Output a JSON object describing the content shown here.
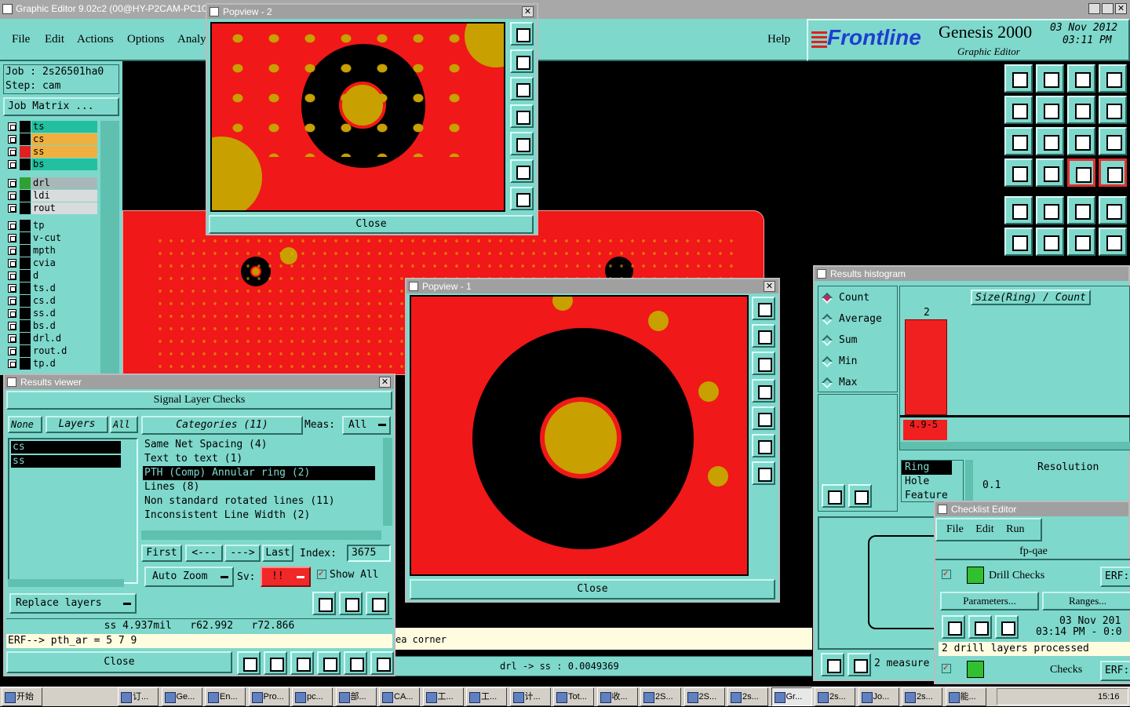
{
  "main": {
    "title": "Graphic Editor 9.02c2 (00@HY-P2CAM-PC10",
    "menu": [
      "File",
      "Edit",
      "Actions",
      "Options",
      "Analy"
    ],
    "help": "Help",
    "brand": "Frontline",
    "product": "Genesis 2000",
    "subtitle": "Graphic Editor",
    "date": "03 Nov 2012",
    "time": "03:11 PM",
    "job": "Job : 2s26501ha0",
    "step": "Step: cam",
    "job_matrix": "Job Matrix ...",
    "status_line": "drl -> ss : 0.0049369",
    "area_text": "ea corner"
  },
  "layers": [
    {
      "name": "ts",
      "color": "#22c0a0",
      "mark": "#000"
    },
    {
      "name": "cs",
      "color": "#f0b040",
      "mark": "#000"
    },
    {
      "name": "ss",
      "color": "#f0b040",
      "mark": "#e02020"
    },
    {
      "name": "bs",
      "color": "#22c0a0",
      "mark": "#000"
    },
    {
      "name": "drl",
      "color": "#a8b8b8",
      "mark": "#30a030"
    },
    {
      "name": "ldi",
      "color": "#d8dcdc",
      "mark": "#000"
    },
    {
      "name": "rout",
      "color": "#d8dcdc",
      "mark": "#000"
    },
    {
      "name": "tp",
      "color": "#7fd8cc",
      "mark": "#000"
    },
    {
      "name": "v-cut",
      "color": "#7fd8cc",
      "mark": "#000"
    },
    {
      "name": "mpth",
      "color": "#7fd8cc",
      "mark": "#000"
    },
    {
      "name": "cvia",
      "color": "#7fd8cc",
      "mark": "#000"
    },
    {
      "name": "d",
      "color": "#7fd8cc",
      "mark": "#000"
    },
    {
      "name": "ts.d",
      "color": "#7fd8cc",
      "mark": "#000"
    },
    {
      "name": "cs.d",
      "color": "#7fd8cc",
      "mark": "#000"
    },
    {
      "name": "ss.d",
      "color": "#7fd8cc",
      "mark": "#000"
    },
    {
      "name": "bs.d",
      "color": "#7fd8cc",
      "mark": "#000"
    },
    {
      "name": "drl.d",
      "color": "#7fd8cc",
      "mark": "#000"
    },
    {
      "name": "rout.d",
      "color": "#7fd8cc",
      "mark": "#000"
    },
    {
      "name": "tp.d",
      "color": "#7fd8cc",
      "mark": "#000"
    }
  ],
  "popview2": {
    "title": "Popview - 2",
    "close": "Close"
  },
  "popview1": {
    "title": "Popview - 1",
    "close": "Close"
  },
  "results": {
    "title": "Results viewer",
    "header": "Signal Layer Checks",
    "none": "None",
    "layers": "Layers",
    "all": "All",
    "categories": "Categories (11)",
    "meas_label": "Meas:",
    "meas_value": "All",
    "layer_items": [
      "cs",
      "ss"
    ],
    "cat_items": [
      "Same Net Spacing (4)",
      "Text to text (1)",
      "PTH (Comp) Annular ring (2)",
      "Lines (8)",
      "Non standard rotated lines (11)",
      "Inconsistent Line Width (2)"
    ],
    "first": "First",
    "prev": "<---",
    "next": "--->",
    "last": "Last",
    "index_label": "Index:",
    "index_value": "3675",
    "auto_zoom": "Auto Zoom",
    "sv_label": "Sv:",
    "sv_value": "!!",
    "show_all": "Show All",
    "replace_layers": "Replace layers",
    "info_line": "ss 4.937mil   r62.992   r72.866",
    "erf_line": "ERF--> pth_ar = 5 7 9",
    "close": "Close"
  },
  "histogram": {
    "title": "Results histogram",
    "options": [
      "Count",
      "Average",
      "Sum",
      "Min",
      "Max"
    ],
    "chart_title": "Size(Ring) / Count",
    "bar_value": "2",
    "bar_label": "4.9-5",
    "list": [
      "Ring",
      "Hole",
      "Feature"
    ],
    "resolution_label": "Resolution",
    "resolution_value": "0.1",
    "measure_text": "2 measure"
  },
  "checklist": {
    "title": "Checklist Editor",
    "menu": [
      "File",
      "Edit",
      "Run"
    ],
    "name": "fp-qae",
    "check1": "Drill Checks",
    "erf": "ERF:",
    "params": "Parameters...",
    "ranges": "Ranges...",
    "date": "03 Nov 201",
    "time": "03:14 PM - 0:0",
    "processed": "2 drill layers processed",
    "check2": "Checks",
    "erf2": "ERF:"
  },
  "taskbar": {
    "start": "开始",
    "items": [
      "订...",
      "Ge...",
      "En...",
      "Pro...",
      "pc...",
      "部...",
      "CA...",
      "工...",
      "工...",
      "计...",
      "Tot...",
      "收...",
      "2S...",
      "2S...",
      "2s...",
      "Gr...",
      "2s...",
      "Jo...",
      "2s...",
      "能..."
    ],
    "clock": "15:16"
  }
}
